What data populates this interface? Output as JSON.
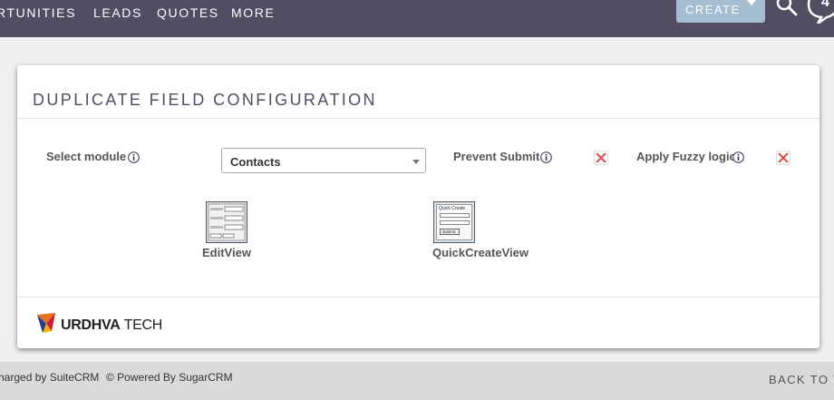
{
  "nav": {
    "items": [
      "RTUNITIES",
      "LEADS",
      "QUOTES",
      "MORE"
    ],
    "create_label": "CREATE",
    "notification_count": "4"
  },
  "panel": {
    "title": "DUPLICATE FIELD CONFIGURATION",
    "select_module_label": "Select module",
    "module_value": "Contacts",
    "prevent_submit_label": "Prevent Submit",
    "fuzzy_logic_label": "Apply Fuzzy logic",
    "views": [
      "EditView",
      "QuickCreateView"
    ],
    "quick_create_mini": {
      "title": "Quick Create",
      "submit": "Submit"
    }
  },
  "logo": {
    "brand": "URDHVA",
    "suffix": "TECH"
  },
  "footer": {
    "supercharged": "harged by SuiteCRM",
    "powered": "© Powered By SugarCRM",
    "back_to_top": "BACK TO TO"
  },
  "colors": {
    "nav_bg": "#534d64",
    "create_btn": "#a5bdd0",
    "x_red": "#d9534f",
    "footer_bg": "#dadada"
  }
}
